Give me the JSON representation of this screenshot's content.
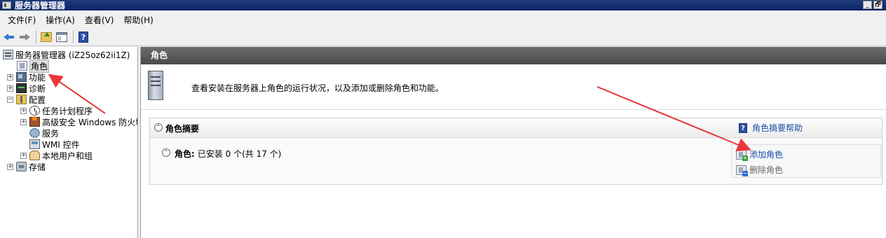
{
  "window": {
    "title": "服务器管理器",
    "minimize_glyph": "_",
    "restore_glyph": "🗗"
  },
  "menu": {
    "items": [
      {
        "label": "文件(F)"
      },
      {
        "label": "操作(A)"
      },
      {
        "label": "查看(V)"
      },
      {
        "label": "帮助(H)"
      }
    ]
  },
  "toolbar": {
    "icons": [
      "back-arrow-icon",
      "forward-arrow-icon",
      "up-folder-icon",
      "show-console-tree-icon",
      "help-icon"
    ],
    "help_glyph": "?"
  },
  "tree": {
    "expand_glyph": "+",
    "collapse_glyph": "−",
    "root": {
      "label": "服务器管理器 (iZ25oz62ii1Z)"
    },
    "roles": {
      "label": "角色"
    },
    "features": {
      "label": "功能"
    },
    "diagnostics": {
      "label": "诊断"
    },
    "configuration": {
      "label": "配置"
    },
    "task_scheduler": {
      "label": "任务计划程序"
    },
    "firewall": {
      "label": "高级安全 Windows 防火墙"
    },
    "services": {
      "label": "服务"
    },
    "wmi": {
      "label": "WMI 控件"
    },
    "local_users": {
      "label": "本地用户和组"
    },
    "storage": {
      "label": "存储"
    }
  },
  "main": {
    "header": "角色",
    "intro": "查看安装在服务器上角色的运行状况，以及添加或删除角色和功能。",
    "roles_panel": {
      "collapse_glyph": "⌃",
      "title": "角色摘要",
      "help_link": "角色摘要帮助",
      "summary_label": "角色:",
      "summary_value": "已安装 0 个(共 17 个)",
      "actions": [
        {
          "label": "添加角色",
          "enabled": true
        },
        {
          "label": "删除角色",
          "enabled": false
        }
      ]
    }
  },
  "colors": {
    "title_bar": "#0a246a",
    "header_bar": "#555555",
    "link": "#1a4fa6",
    "annotation_arrow": "#e8383d"
  }
}
